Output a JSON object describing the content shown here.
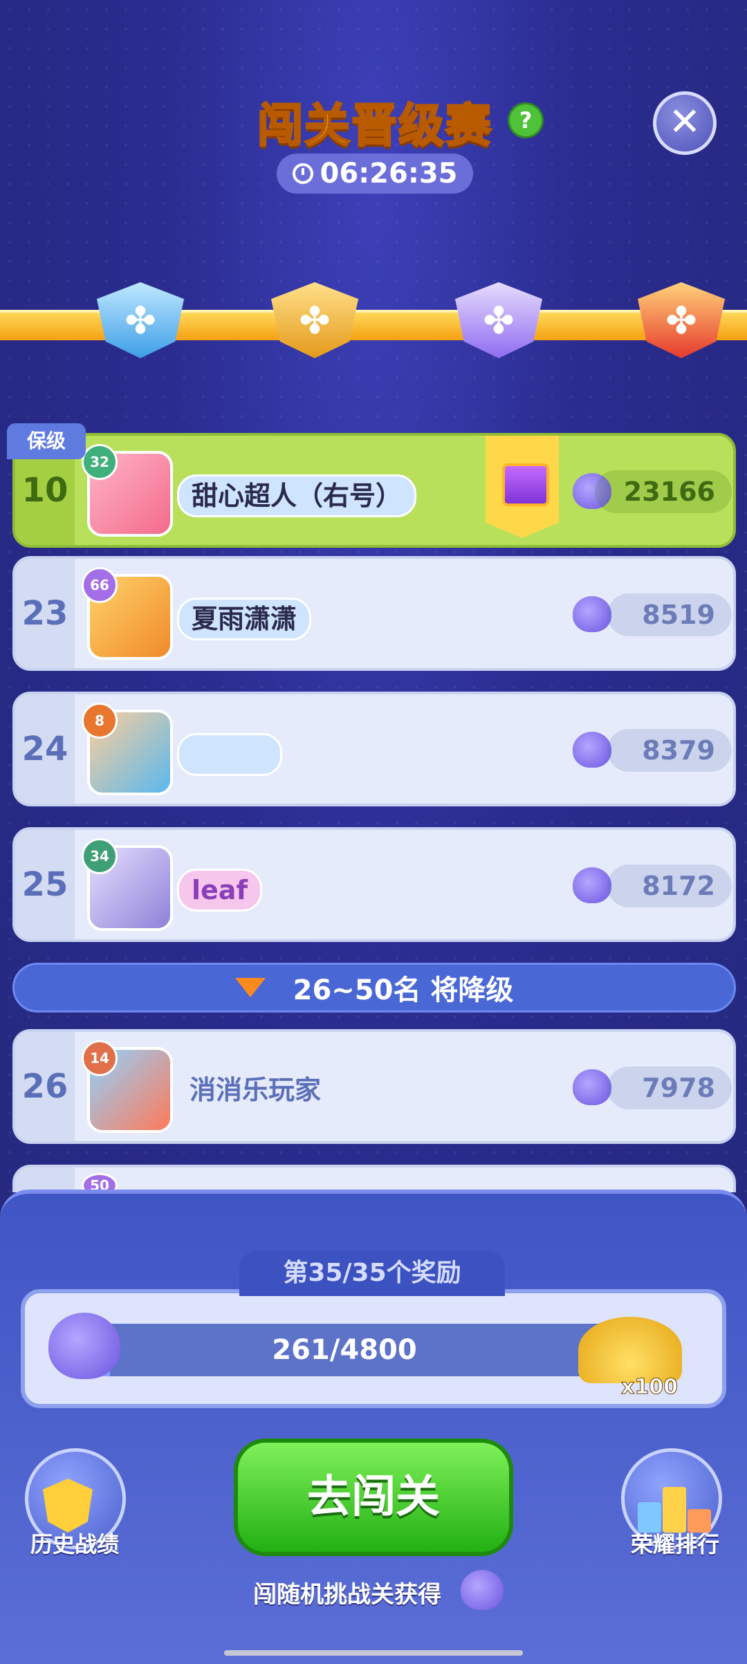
{
  "header": {
    "title": "闯关晋级赛",
    "help_icon": "question-icon",
    "help_glyph": "?",
    "close_icon": "close-icon",
    "close_glyph": "✕",
    "timer": "06:26:35"
  },
  "tiers": [
    "tier-blue-badge",
    "tier-gold-badge",
    "tier-purple-badge",
    "tier-red-badge"
  ],
  "tier_glyph": "✤",
  "protect_label": "保级",
  "rows": [
    {
      "rank": "10",
      "level": "32",
      "name": "甜心超人（右号）",
      "score": "23166",
      "highlight": true
    },
    {
      "rank": "23",
      "level": "66",
      "name": "夏雨潇潇",
      "score": "8519"
    },
    {
      "rank": "24",
      "level": "8",
      "name": "",
      "score": "8379"
    },
    {
      "rank": "25",
      "level": "34",
      "name": "leaf",
      "score": "8172"
    },
    {
      "rank": "26",
      "level": "14",
      "name": "消消乐玩家",
      "score": "7978"
    }
  ],
  "demotion_banner": "26~50名 将降级",
  "partial_row_level": "50",
  "reward": {
    "title": "第35/35个奖励",
    "progress_text": "261/4800",
    "progress_value": 261,
    "progress_max": 4800,
    "multiplier": "x100"
  },
  "buttons": {
    "go": "去闯关",
    "history": "历史战绩",
    "ranking": "荣耀排行"
  },
  "hint": "闯随机挑战关获得",
  "colors": {
    "background": "#2a2c8f",
    "highlight_row": "#b8e05a",
    "go_button": "#22b012",
    "title": "#ffd15c"
  }
}
